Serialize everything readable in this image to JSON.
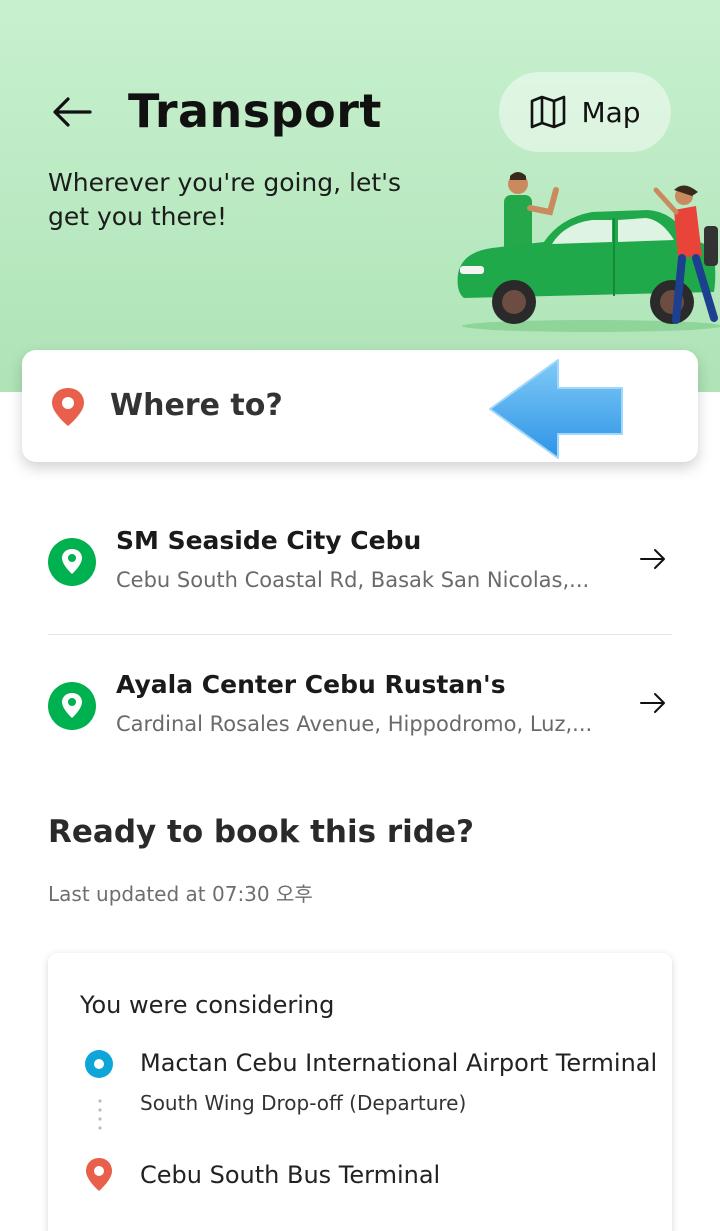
{
  "header": {
    "title": "Transport",
    "map_label": "Map",
    "subtitle": "Wherever you're going, let's get you there!",
    "bg_color": "#b9eac0"
  },
  "search": {
    "placeholder_text": "Where to?",
    "pin_color": "#e8604c",
    "annotation_arrow_color": "#4aaef0"
  },
  "saved_places": [
    {
      "name": "SM Seaside City Cebu",
      "address": "Cebu South Coastal Rd, Basak San Nicolas,...",
      "icon": "location-pin-icon"
    },
    {
      "name": "Ayala Center Cebu Rustan's",
      "address": "Cardinal Rosales Avenue, Hippodromo, Luz,...",
      "icon": "location-pin-icon"
    }
  ],
  "ready": {
    "title": "Ready to book this ride?",
    "last_updated": "Last updated at 07:30 오후"
  },
  "ride": {
    "heading": "You were considering",
    "origin_name": "Mactan Cebu International Airport Terminal",
    "origin_sub": "South Wing Drop-off (Departure)",
    "destination_name": "Cebu South Bus Terminal",
    "origin_color": "#0ea5d8",
    "destination_color": "#e8604c"
  },
  "colors": {
    "brand_green": "#00b14f"
  }
}
